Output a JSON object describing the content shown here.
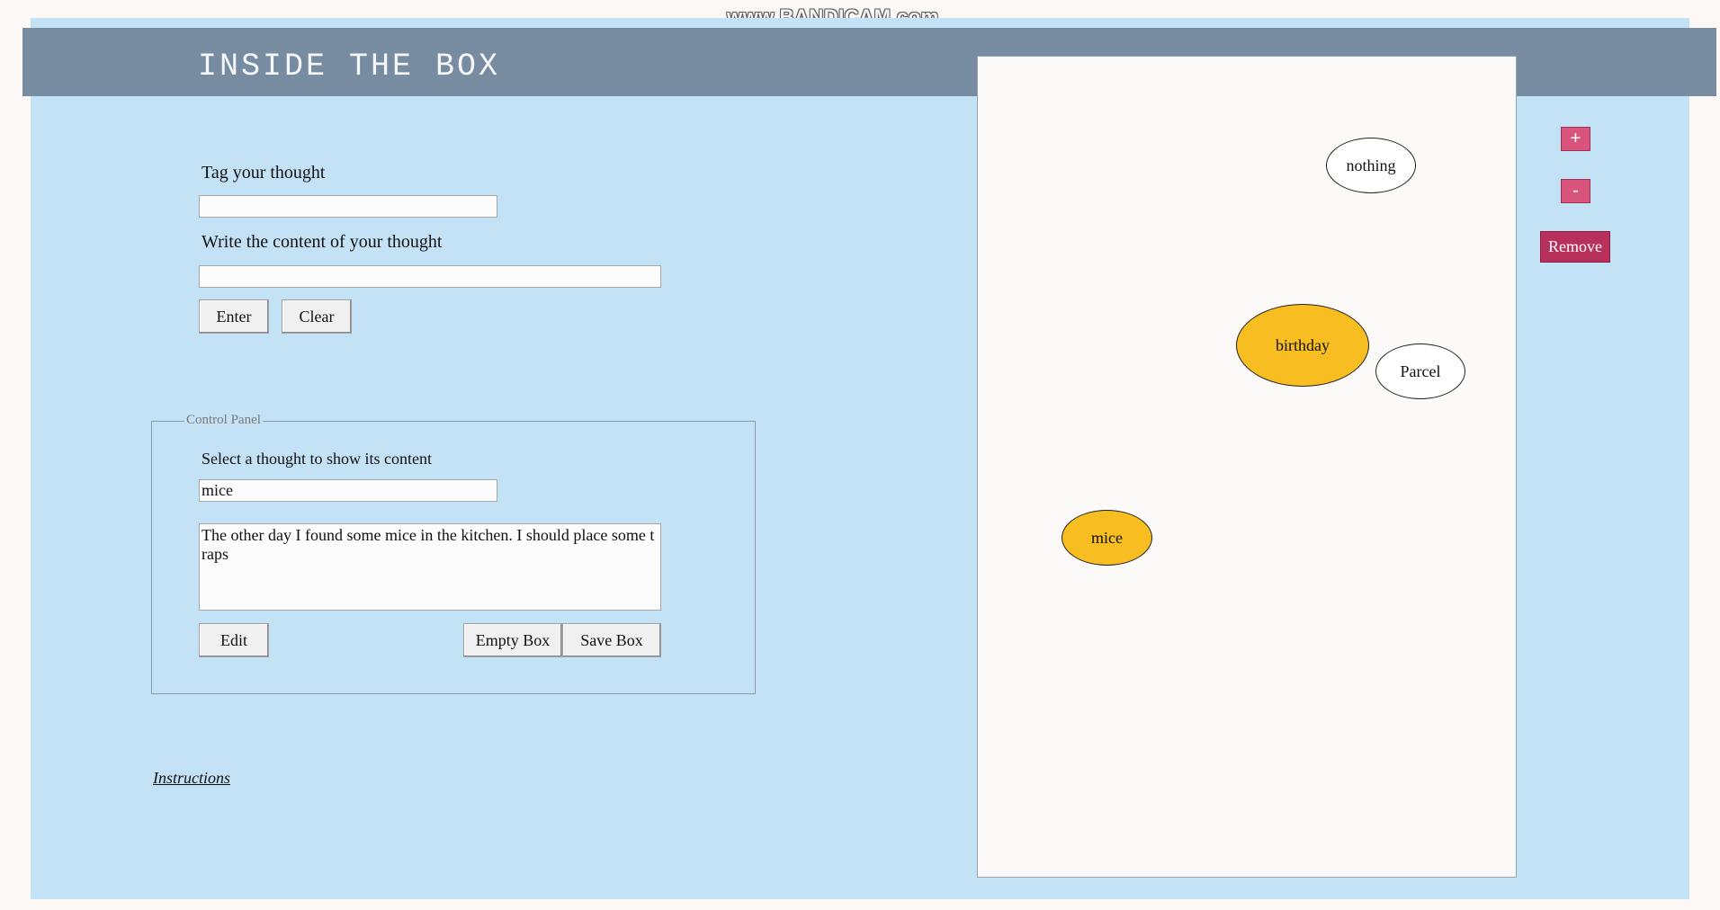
{
  "watermark": "www.BANDICAM.com",
  "header": {
    "title": "INSIDE THE BOX"
  },
  "form": {
    "tag_label": "Tag your thought",
    "tag_value": "",
    "content_label": "Write the content of your thought",
    "content_value": "",
    "enter_label": "Enter",
    "clear_label": "Clear"
  },
  "control_panel": {
    "legend": "Control Panel",
    "select_label": "Select a thought to show its content",
    "selected_value": "mice",
    "content_text": "The other day I found some mice in the kitchen. I should place some traps",
    "edit_label": "Edit",
    "empty_label": "Empty Box",
    "save_label": "Save Box"
  },
  "instructions_link": "Instructions",
  "box": {
    "thoughts": [
      {
        "label": "nothing",
        "selected": false
      },
      {
        "label": "birthday",
        "selected": true
      },
      {
        "label": "Parcel",
        "selected": false
      },
      {
        "label": "mice",
        "selected": true
      }
    ]
  },
  "side_controls": {
    "zoom_in": "+",
    "zoom_out": "-",
    "remove": "Remove"
  },
  "colors": {
    "page_bg": "#c4e2f6",
    "header_bg": "#778ca0",
    "selected_thought": "#f8bd20",
    "accent_button": "#d8547c",
    "remove_button": "#b8305c"
  }
}
